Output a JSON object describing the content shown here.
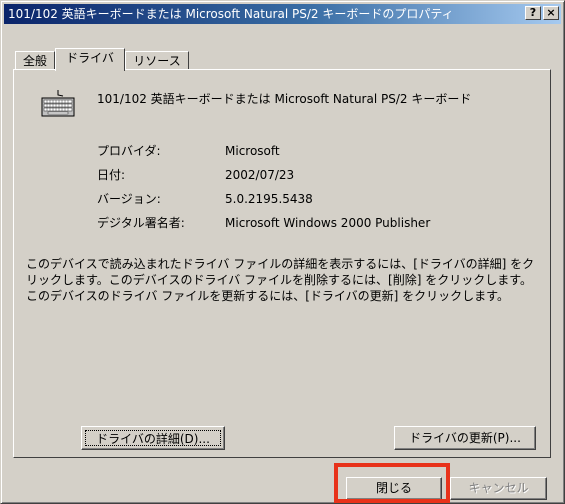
{
  "window": {
    "title": "101/102 英語キーボードまたは Microsoft Natural PS/2 キーボードのプロパティ",
    "help_btn": "?",
    "close_btn": "×"
  },
  "tabs": [
    {
      "label": "全般"
    },
    {
      "label": "ドライバ"
    },
    {
      "label": "リソース"
    }
  ],
  "device": {
    "icon": "keyboard-icon",
    "name": "101/102 英語キーボードまたは Microsoft Natural PS/2 キーボード"
  },
  "properties": [
    {
      "label": "プロバイダ:",
      "value": "Microsoft"
    },
    {
      "label": "日付:",
      "value": "2002/07/23"
    },
    {
      "label": "バージョン:",
      "value": "5.0.2195.5438"
    },
    {
      "label": "デジタル署名者:",
      "value": "Microsoft Windows 2000 Publisher"
    }
  ],
  "description": "このデバイスで読み込まれたドライバ ファイルの詳細を表示するには、[ドライバの詳細] をクリックします。このデバイスのドライバ ファイルを削除するには、[削除] をクリックします。このデバイスのドライバ ファイルを更新するには、[ドライバの更新] をクリックします。",
  "buttons": {
    "details": "ドライバの詳細(D)...",
    "update": "ドライバの更新(P)...",
    "close": "閉じる",
    "cancel": "キャンセル"
  },
  "colors": {
    "highlight": "#e8321a",
    "titlebar_start": "#0a246a",
    "face": "#d4d0c8"
  }
}
